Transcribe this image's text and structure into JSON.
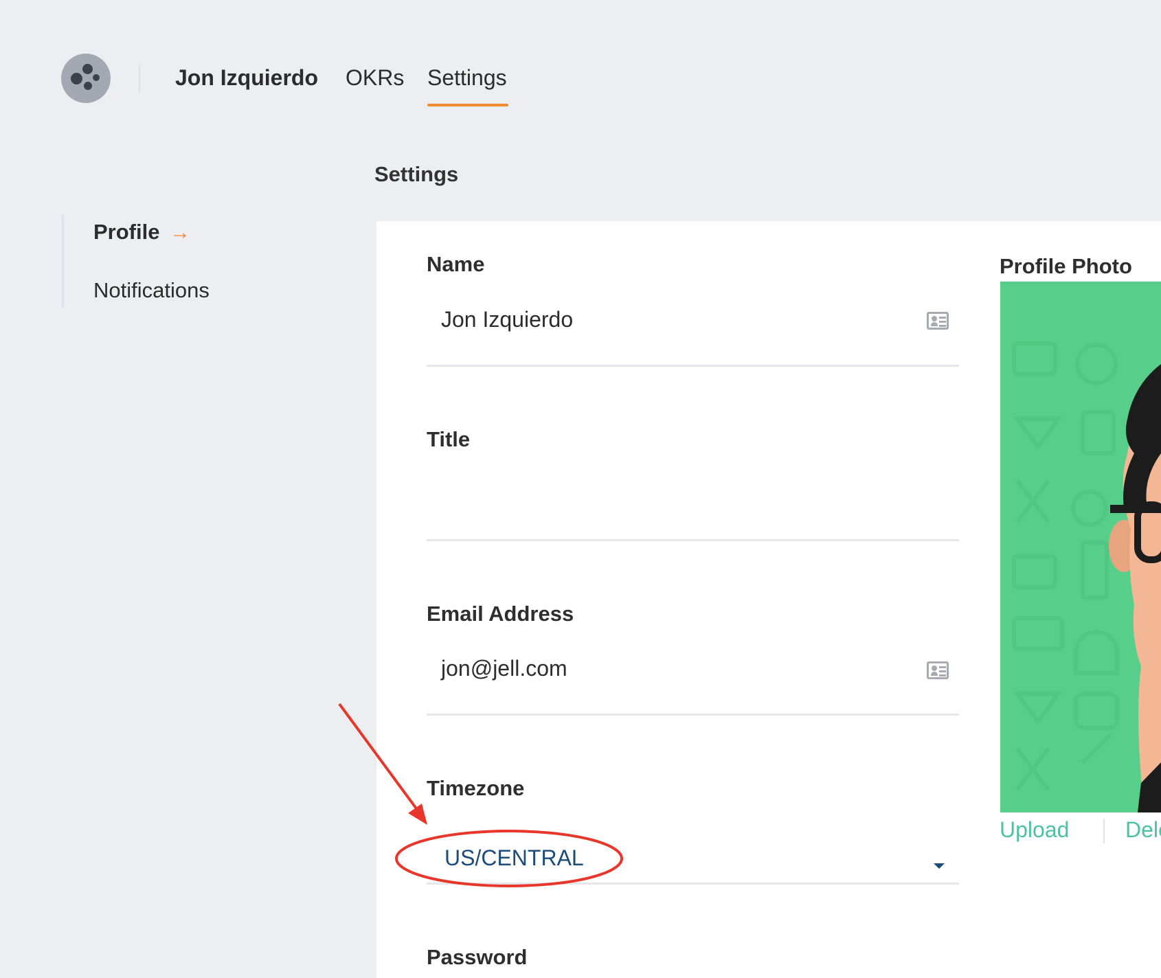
{
  "nav": {
    "user_name": "Jon Izquierdo",
    "items": [
      {
        "label": "OKRs"
      },
      {
        "label": "Settings",
        "active": true
      }
    ],
    "accent_color": "#f28a2f"
  },
  "page": {
    "heading": "Settings"
  },
  "sidebar": {
    "items": [
      {
        "label": "Profile",
        "active": true
      },
      {
        "label": "Notifications"
      }
    ]
  },
  "form": {
    "name": {
      "label": "Name",
      "value": "Jon Izquierdo",
      "icon": "contact-card-icon"
    },
    "title": {
      "label": "Title",
      "value": ""
    },
    "email": {
      "label": "Email Address",
      "value": "jon@jell.com",
      "icon": "contact-card-icon"
    },
    "timezone": {
      "label": "Timezone",
      "value": "US/CENTRAL"
    },
    "password": {
      "label": "Password"
    }
  },
  "profile_photo": {
    "label": "Profile Photo",
    "background_color": "#57cf8a",
    "upload_label": "Upload",
    "delete_label": "Dele"
  },
  "annotation": {
    "color": "#e8372a"
  }
}
